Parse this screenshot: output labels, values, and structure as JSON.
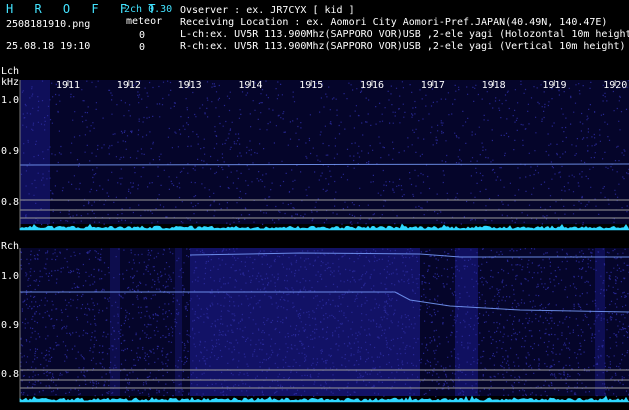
{
  "app": {
    "logo": "H R O F F T",
    "version": "2ch 0.30",
    "meteor_label": "meteor"
  },
  "file": {
    "name": "2508181910.png",
    "datetime": "25.08.18 19:10",
    "meteor_count_l": "0",
    "meteor_count_r": "0"
  },
  "info": {
    "observer": "Ovserver             : ex. JR7CYX [ kid ]",
    "location": "Receiving Location : ex. Aomori City Aomori-Pref.JAPAN(40.49N, 140.47E)",
    "lch": "L-ch:ex. UV5R 113.900Mhz(SAPPORO VOR)USB ,2-ele yagi (Holozontal 10m height)",
    "rch": "R-ch:ex. UV5R 113.900Mhz(SAPPORO VOR)USB ,2-ele yagi (Vertical 10m height)"
  },
  "time_ticks": [
    "1911",
    "1912",
    "1913",
    "1914",
    "1915",
    "1916",
    "1917",
    "1918",
    "1919",
    "1920"
  ],
  "lch": {
    "label": "Lch",
    "unit": "kHz",
    "ticks": [
      "1.0",
      "0.9",
      "0.8"
    ]
  },
  "rch": {
    "label": "Rch",
    "ticks": [
      "1.0",
      "0.9",
      "0.8"
    ]
  },
  "colors": {
    "accent": "#43e3ff",
    "noise": "#2a2a9a",
    "signal": "#7aa0ff",
    "baseline": "#2fd8ff"
  }
}
